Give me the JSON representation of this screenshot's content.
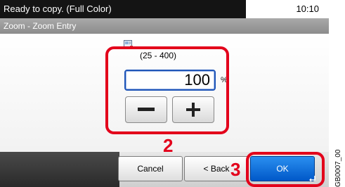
{
  "status": {
    "message": "Ready to copy. (Full Color)",
    "time": "10:10"
  },
  "title": "Zoom - Zoom Entry",
  "zoom": {
    "range": "(25 - 400)",
    "value": "100",
    "unit": "%",
    "icon": "zoom-entry-icon",
    "minus_icon": "minus-icon",
    "plus_icon": "plus-icon"
  },
  "footer": {
    "cancel": "Cancel",
    "back": "< Back",
    "ok": "OK"
  },
  "callouts": {
    "step2": "2",
    "step3": "3"
  },
  "figure_code": "GB0007_00",
  "colors": {
    "callout": "#e3001b",
    "ok_button": "#0a6fe0",
    "field_border": "#1f55b8"
  }
}
